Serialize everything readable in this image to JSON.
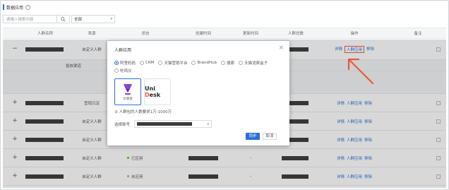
{
  "header": {
    "title": "数据应用"
  },
  "search": {
    "placeholder": "请输入搜索内容",
    "filter_value": "全部"
  },
  "table": {
    "columns": [
      "人群名称",
      "来源",
      "状态",
      "创建时间",
      "更新时间",
      "人群总数",
      "操作",
      "备注"
    ],
    "expanded_row": {
      "source": "自定义人群",
      "actions": [
        "详情",
        "人群应用",
        "移除"
      ]
    },
    "sub_header": [
      "投放渠道"
    ],
    "rows": [
      {
        "source": "营销沉淀",
        "actions": [
          "详情",
          "人群应用",
          "移除"
        ]
      },
      {
        "source": "自定义人群",
        "actions": [
          "详情",
          "人群应用",
          "移除"
        ]
      },
      {
        "source": "自定义人群",
        "actions": [
          "详情",
          "人群应用",
          "移除"
        ]
      },
      {
        "source": "自定义人群",
        "status": "已应用",
        "actions": [
          "详情",
          "人群应用",
          "移除"
        ]
      },
      {
        "source": "自定义人群",
        "status": "未应用",
        "actions": [
          "详情",
          "人群应用",
          "移除"
        ]
      }
    ],
    "create_cell": "-",
    "update_cell": "-"
  },
  "modal": {
    "title": "人群应用",
    "options": [
      "阿里妈妈",
      "CRM",
      "天猫营销平台",
      "BrandHub",
      "搜索",
      "天猫消费盒子",
      "吃鸡仪"
    ],
    "cards": [
      {
        "caption": "达摩盘"
      },
      {
        "logo_a": "Uni ",
        "logo_b": "D",
        "logo_c": "esk"
      }
    ],
    "note": "① 人群包的人数要求1万-1000万",
    "account_label": "选择账号",
    "confirm": "同步",
    "cancel": "取消"
  },
  "colors": {
    "accent": "#2a6fdb",
    "highlight": "#e8583a",
    "applied": "#52c41a",
    "unapplied": "#aaaaaa"
  }
}
